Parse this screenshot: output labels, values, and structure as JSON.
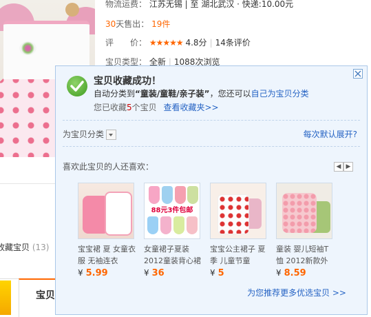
{
  "product": {
    "shipping_label": "物流运费：",
    "shipping_value": "江苏无锡 | 至  湖北武汉 · 快递:10.00元",
    "sold_days": "30",
    "sold_label": "天售出：",
    "sold_count": "19件",
    "rating_label": "评　　价：",
    "stars": "★★★★★",
    "rating_score": "4.8分",
    "review_count": "14条评价",
    "type_label": "宝贝类型：",
    "type_value": "全新",
    "views": "1088次浏览"
  },
  "background": {
    "collected_label": "收藏宝贝",
    "collected_count": "(13)",
    "tab_label": "宝贝"
  },
  "popup": {
    "title": "宝贝收藏成功！",
    "auto_prefix": "自动分类到",
    "auto_category": "“童装/童鞋/亲子装”",
    "auto_suffix": "，您还可以",
    "self_classify_link": "自己为宝贝分类",
    "collected_prefix": "您已收藏",
    "collected_count": "5",
    "collected_suffix": "个宝贝",
    "view_favorites_link": "查看收藏夹>>",
    "classify_label": "为宝贝分类",
    "default_expand_link": "每次默认展开?",
    "also_like": "喜欢此宝贝的人还喜欢：",
    "more_link": "为您推荐更多优选宝贝 >>",
    "badge_text": "88元3件包邮",
    "currency": "¥",
    "items": [
      {
        "title": "宝宝裙 夏 女童衣服 无袖连衣",
        "price": "5.99"
      },
      {
        "title": "女童裙子夏装 2012童装背心裙",
        "price": "36"
      },
      {
        "title": "宝宝公主裙子 夏季 儿童节童",
        "price": "5"
      },
      {
        "title": "童装 婴儿短袖T恤 2012新款外",
        "price": "8.59"
      }
    ]
  }
}
